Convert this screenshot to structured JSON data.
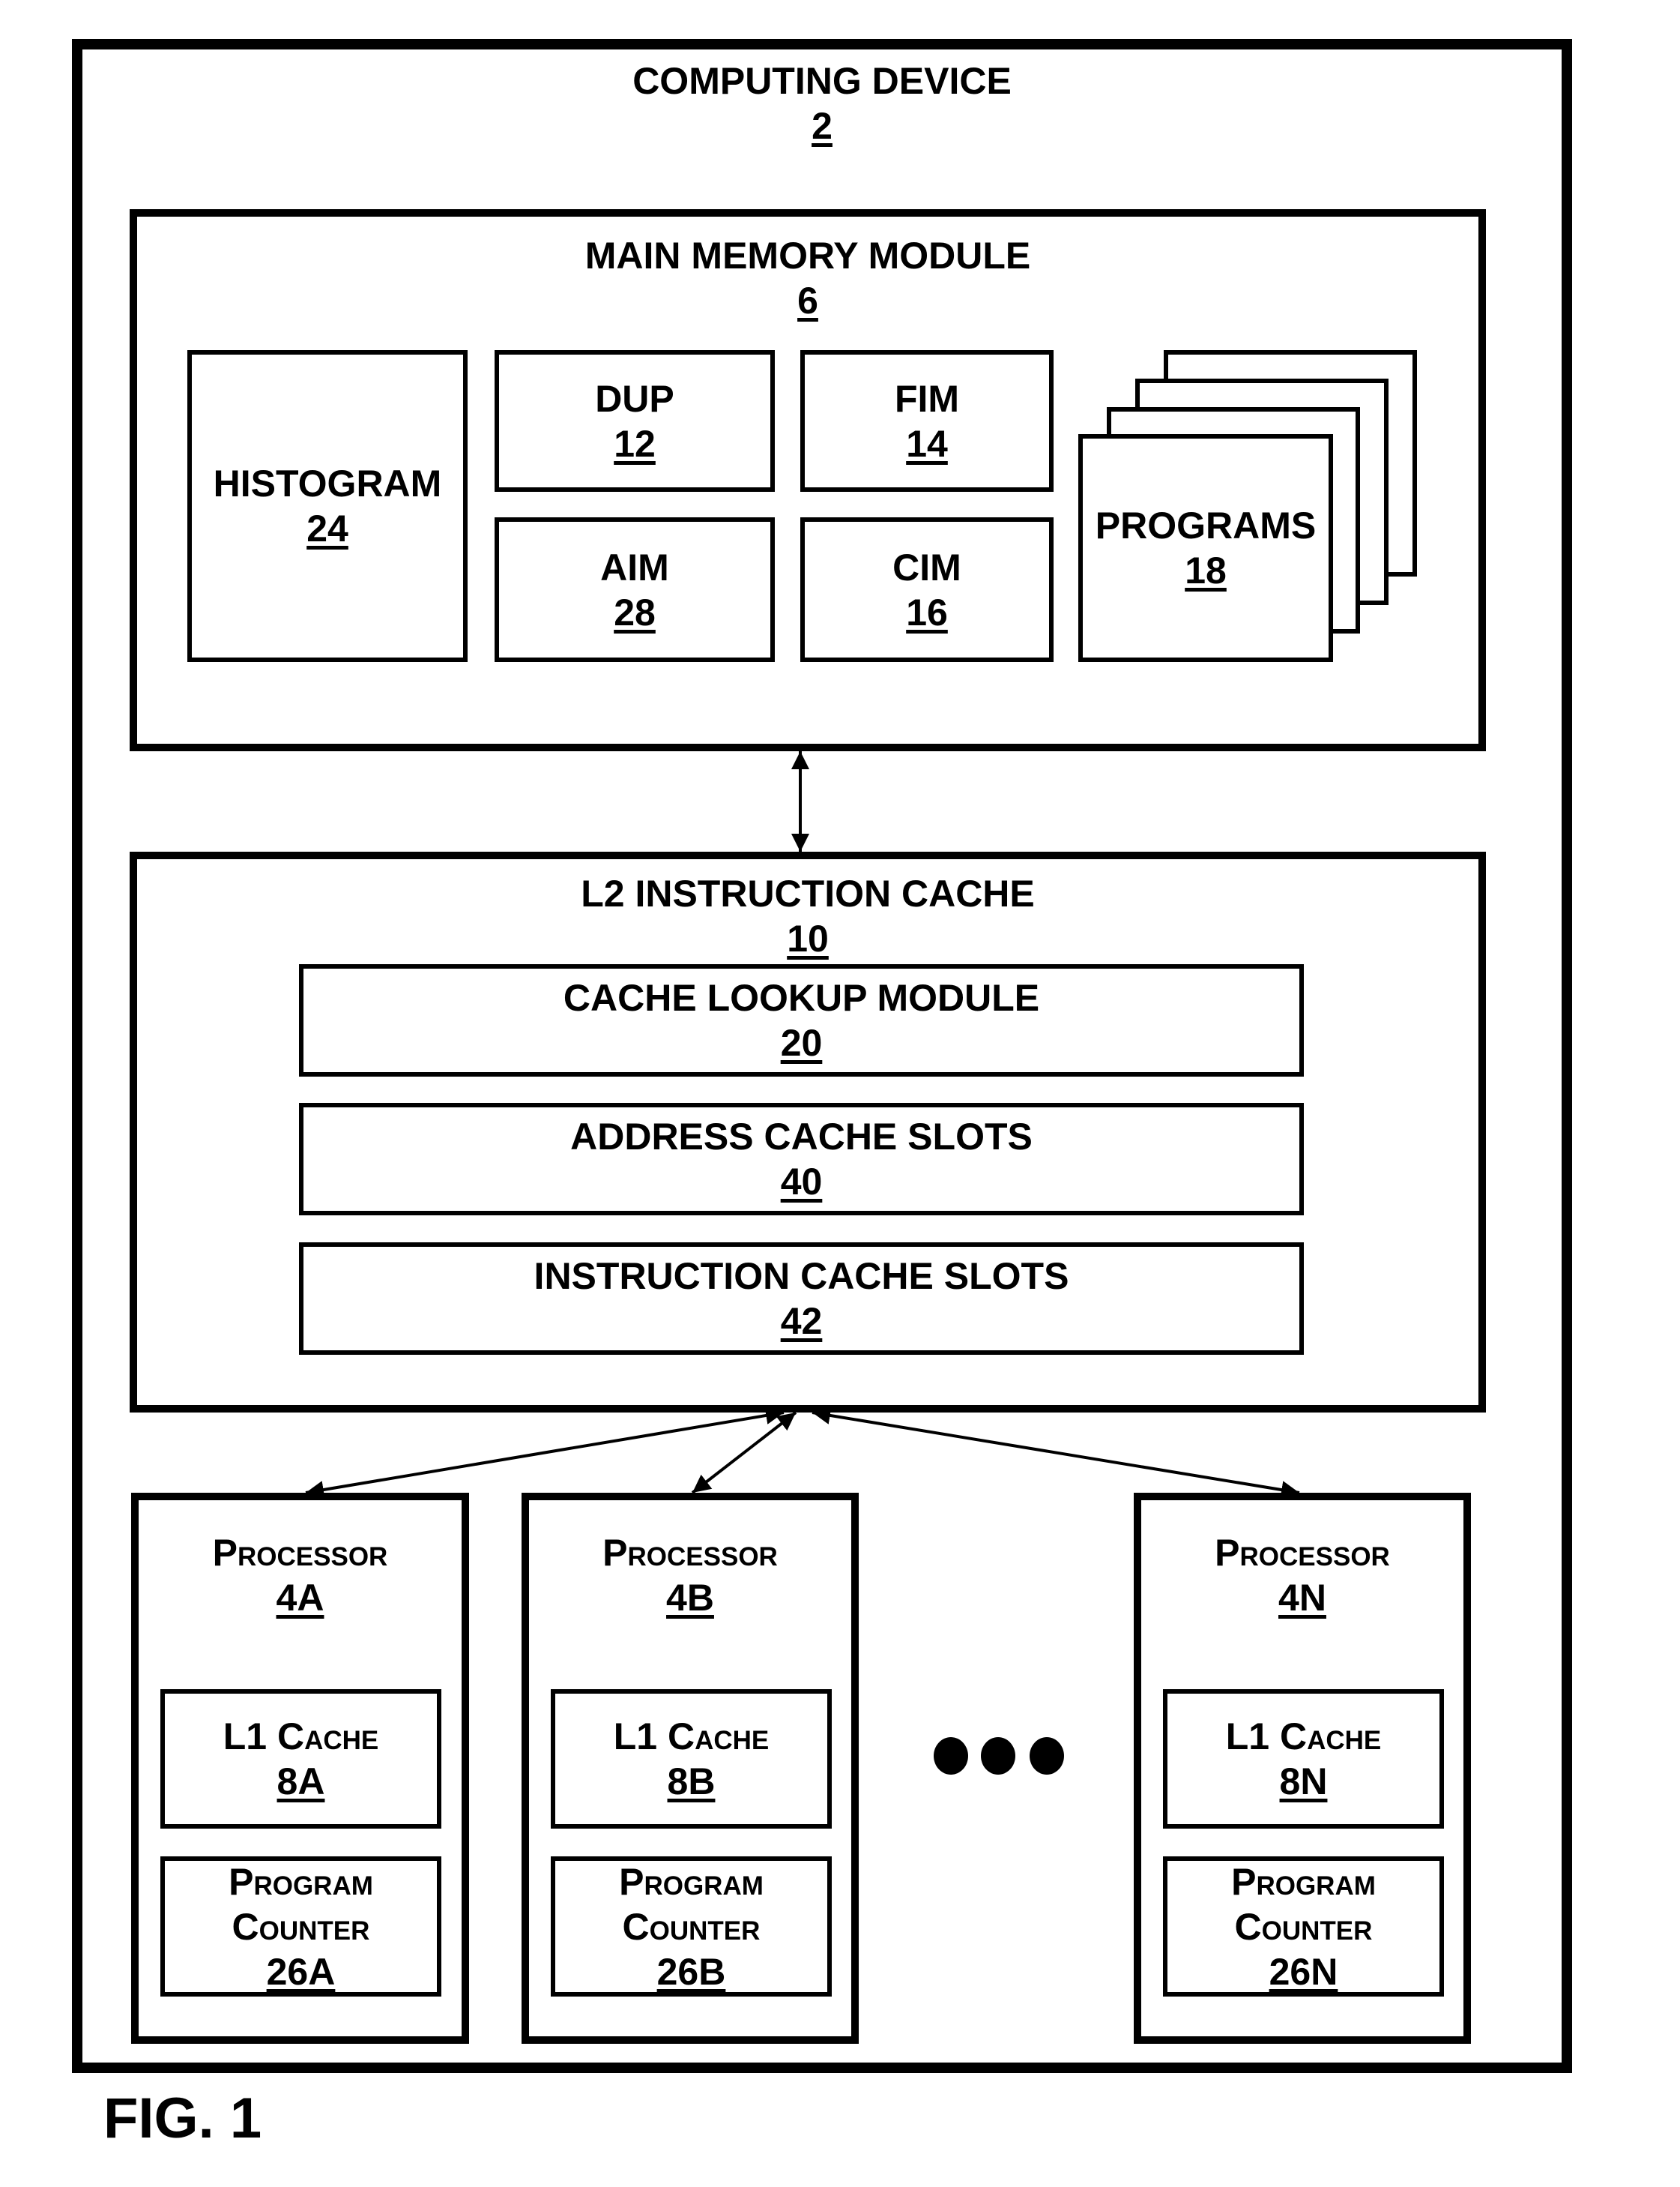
{
  "computing_device": {
    "title": "COMPUTING DEVICE",
    "ref": "2"
  },
  "main_memory": {
    "title": "MAIN MEMORY MODULE",
    "ref": "6",
    "histogram": {
      "title": "HISTOGRAM",
      "ref": "24"
    },
    "dup": {
      "title": "DUP",
      "ref": "12"
    },
    "fim": {
      "title": "FIM",
      "ref": "14"
    },
    "aim": {
      "title": "AIM",
      "ref": "28"
    },
    "cim": {
      "title": "CIM",
      "ref": "16"
    },
    "programs": {
      "title": "PROGRAMS",
      "ref": "18"
    }
  },
  "l2_cache": {
    "title": "L2 INSTRUCTION CACHE",
    "ref": "10",
    "lookup": {
      "title": "CACHE LOOKUP MODULE",
      "ref": "20"
    },
    "address_slots": {
      "title": "ADDRESS CACHE SLOTS",
      "ref": "40"
    },
    "instruction_slots": {
      "title": "INSTRUCTION CACHE SLOTS",
      "ref": "42"
    }
  },
  "processors": [
    {
      "title": "Processor",
      "ref": "4A",
      "l1_title": "L1 Cache",
      "l1_ref": "8A",
      "pc_line1": "Program",
      "pc_line2": "Counter",
      "pc_ref": "26A"
    },
    {
      "title": "Processor",
      "ref": "4B",
      "l1_title": "L1 Cache",
      "l1_ref": "8B",
      "pc_line1": "Program",
      "pc_line2": "Counter",
      "pc_ref": "26B"
    },
    {
      "title": "Processor",
      "ref": "4N",
      "l1_title": "L1 Cache",
      "l1_ref": "8N",
      "pc_line1": "Program",
      "pc_line2": "Counter",
      "pc_ref": "26N"
    }
  ],
  "ellipsis_icon": "three-dots",
  "figure_label": "FIG. 1"
}
